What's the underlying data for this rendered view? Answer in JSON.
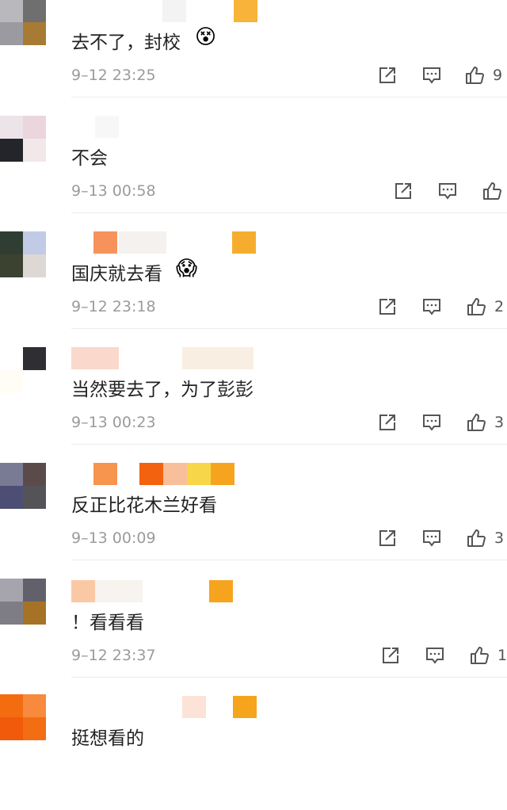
{
  "comments": [
    {
      "text": "去不了，封校",
      "emoji": "😵",
      "time": "9–12 23:25",
      "likes": "9"
    },
    {
      "text": "不会",
      "emoji": "",
      "time": "9–13 00:58",
      "likes": ""
    },
    {
      "text": "国庆就去看",
      "emoji": "😱",
      "time": "9–12 23:18",
      "likes": "2"
    },
    {
      "text": "当然要去了，为了彭彭",
      "emoji": "",
      "time": "9–13 00:23",
      "likes": "3"
    },
    {
      "text": "反正比花木兰好看",
      "emoji": "",
      "time": "9–13 00:09",
      "likes": "3"
    },
    {
      "text": "！看看看",
      "emoji": "",
      "time": "9–12 23:37",
      "likes": "1"
    },
    {
      "text": "挺想看的",
      "emoji": "",
      "time": "",
      "likes": ""
    }
  ],
  "icons": {
    "share": "share-icon",
    "comment": "comment-icon",
    "like": "thumbs-up-icon"
  },
  "colors": {
    "text": "#222222",
    "meta": "#9b9b9b",
    "divider": "#ececec"
  }
}
